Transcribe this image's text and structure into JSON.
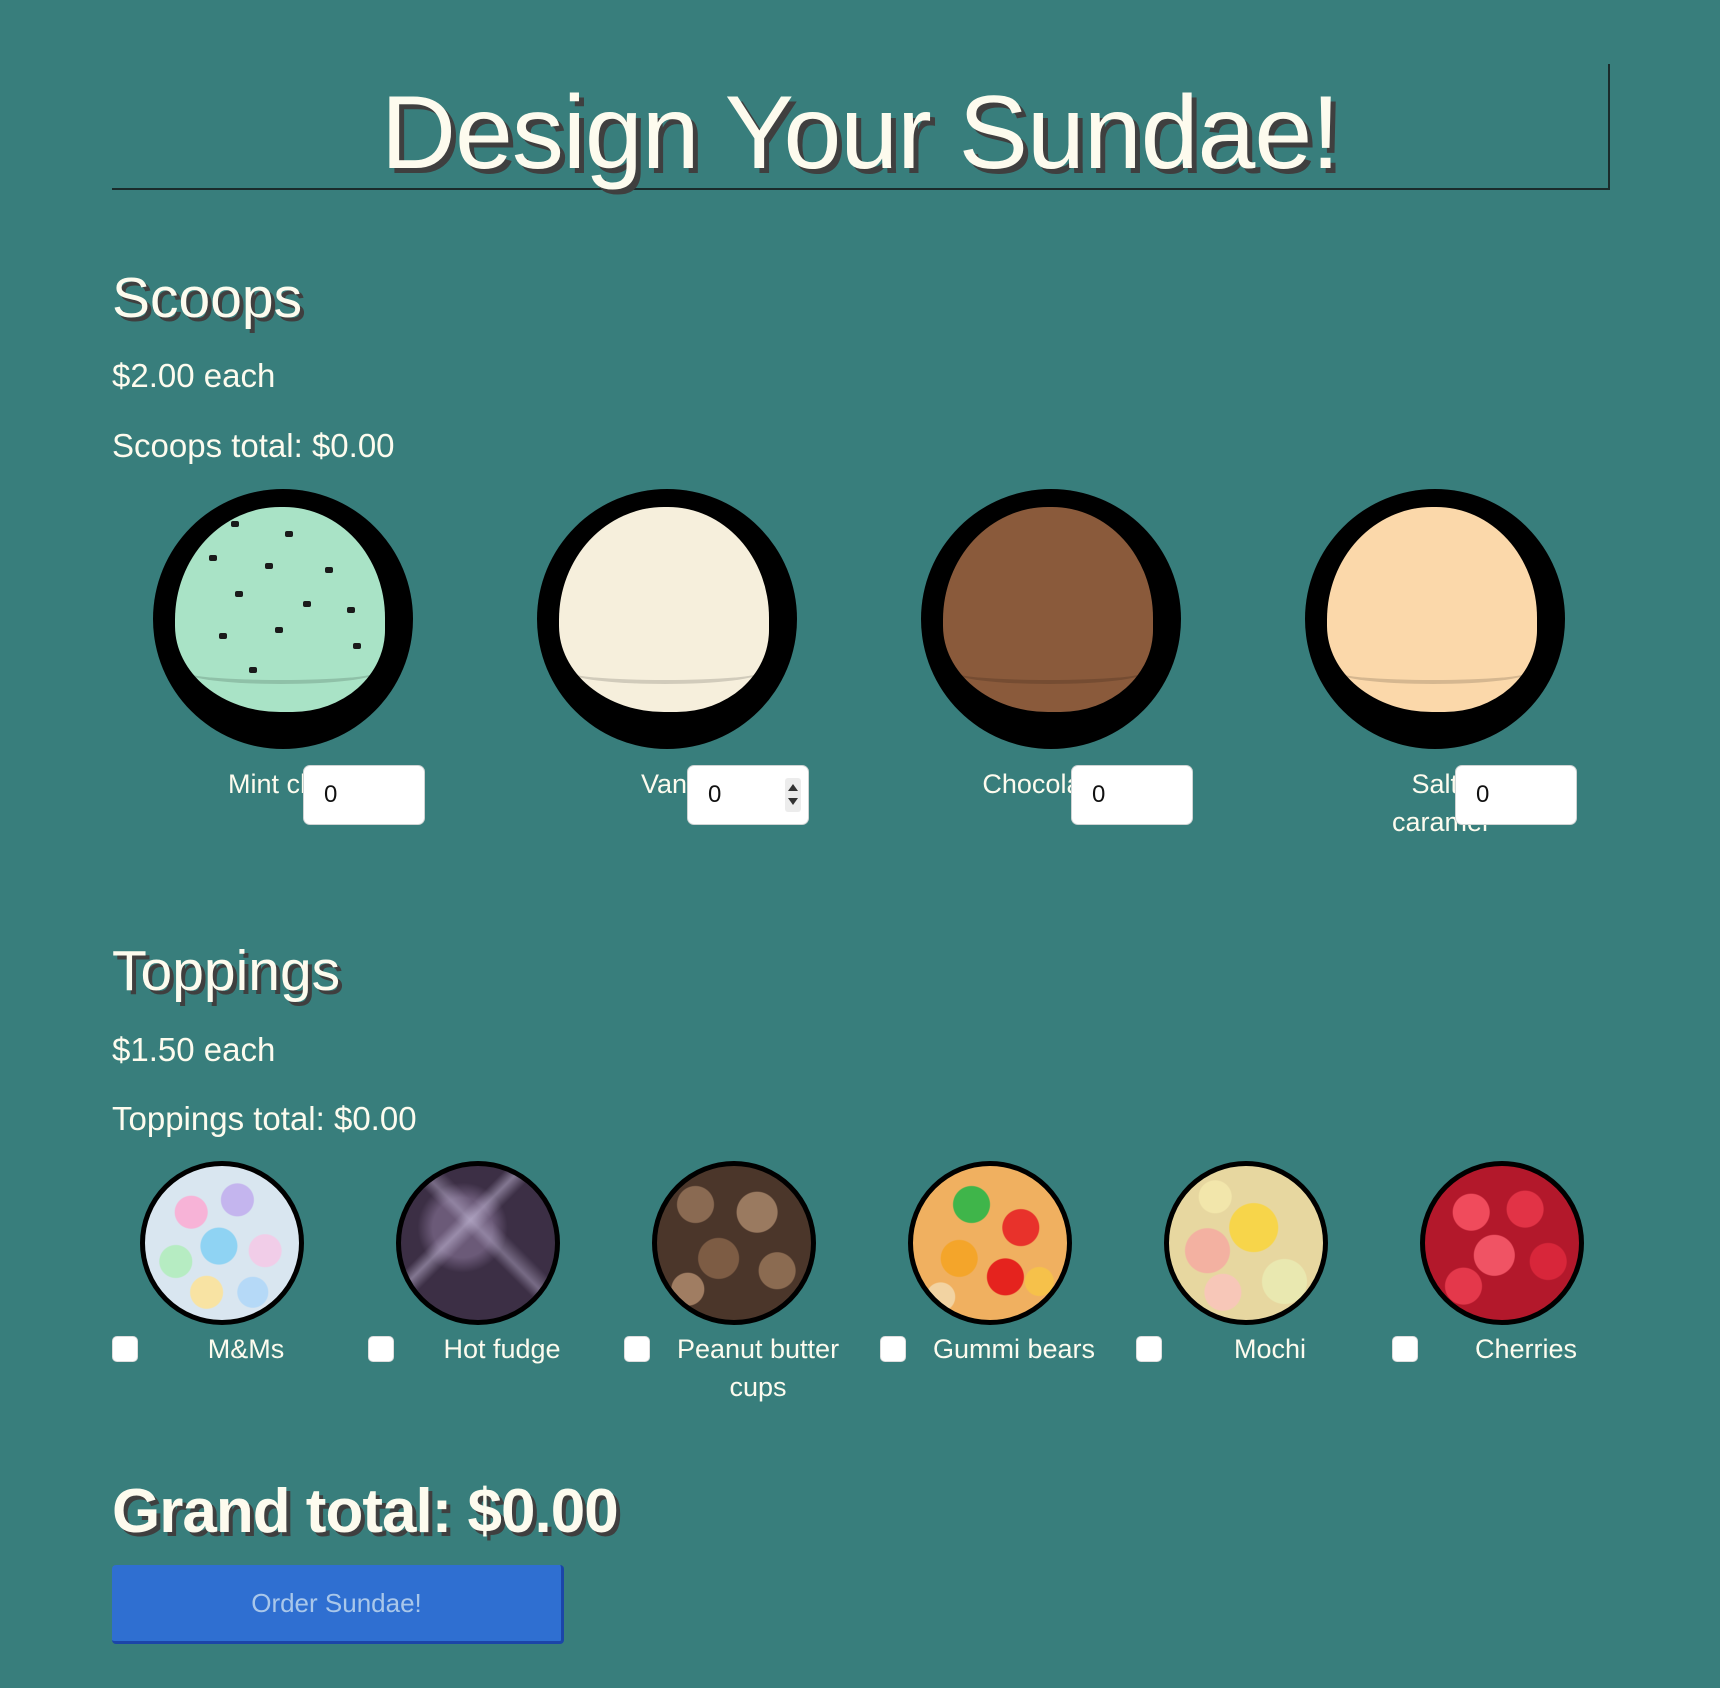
{
  "header": {
    "title": "Design Your Sundae!"
  },
  "scoops": {
    "heading": "Scoops",
    "price_text": "$2.00 each",
    "total_text": "Scoops total: $0.00",
    "items": [
      {
        "label": "Mint chip",
        "value": "0",
        "color": "#a9e3c6",
        "icon": "mint-chip-scoop"
      },
      {
        "label": "Vanilla",
        "value": "0",
        "color": "#f6efdc",
        "icon": "vanilla-scoop"
      },
      {
        "label": "Chocolate",
        "value": "0",
        "color": "#8a5a3b",
        "icon": "chocolate-scoop"
      },
      {
        "label": "Salted caramel",
        "value": "0",
        "color": "#fbd8aa",
        "icon": "salted-caramel-scoop"
      }
    ]
  },
  "toppings": {
    "heading": "Toppings",
    "price_text": "$1.50 each",
    "total_text": "Toppings total: $0.00",
    "items": [
      {
        "label": "M&Ms",
        "checked": false,
        "icon": "mms-topping"
      },
      {
        "label": "Hot fudge",
        "checked": false,
        "icon": "hot-fudge-topping"
      },
      {
        "label": "Peanut butter cups",
        "checked": false,
        "icon": "peanut-butter-cups-topping"
      },
      {
        "label": "Gummi bears",
        "checked": false,
        "icon": "gummi-bears-topping"
      },
      {
        "label": "Mochi",
        "checked": false,
        "icon": "mochi-topping"
      },
      {
        "label": "Cherries",
        "checked": false,
        "icon": "cherries-topping"
      }
    ]
  },
  "summary": {
    "grand_total_text": "Grand total: $0.00",
    "order_button_label": "Order Sundae!"
  },
  "colors": {
    "background": "#387e7c",
    "text": "#fdfbee",
    "button": "#2f6fd1"
  }
}
